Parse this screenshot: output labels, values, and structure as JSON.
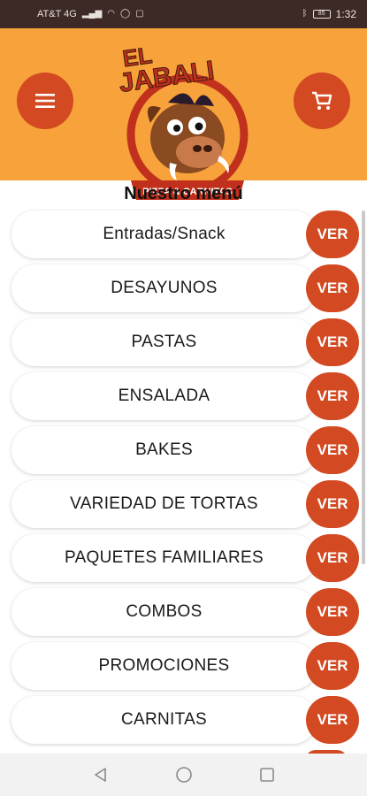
{
  "status_bar": {
    "carrier": "AT&T 4G",
    "battery": "85",
    "time": "1:32"
  },
  "header": {
    "logo_text_line1": "EL",
    "logo_text_line2": "JABALI",
    "logo_banner": "PIZZA & CARNITAS",
    "colors": {
      "header_bg": "#f7a23a",
      "accent": "#d34a22"
    }
  },
  "page": {
    "title": "Nuestro menú"
  },
  "menu": {
    "action_label": "VER",
    "items": [
      {
        "label": "Entradas/Snack"
      },
      {
        "label": "DESAYUNOS"
      },
      {
        "label": "PASTAS"
      },
      {
        "label": "ENSALADA"
      },
      {
        "label": "BAKES"
      },
      {
        "label": "VARIEDAD DE TORTAS"
      },
      {
        "label": "PAQUETES FAMILIARES"
      },
      {
        "label": "COMBOS"
      },
      {
        "label": "PROMOCIONES"
      },
      {
        "label": "CARNITAS"
      }
    ]
  },
  "icons": {
    "menu": "hamburger-icon",
    "cart": "cart-icon",
    "nav_back": "back-triangle-icon",
    "nav_home": "home-circle-icon",
    "nav_recents": "recents-square-icon"
  }
}
